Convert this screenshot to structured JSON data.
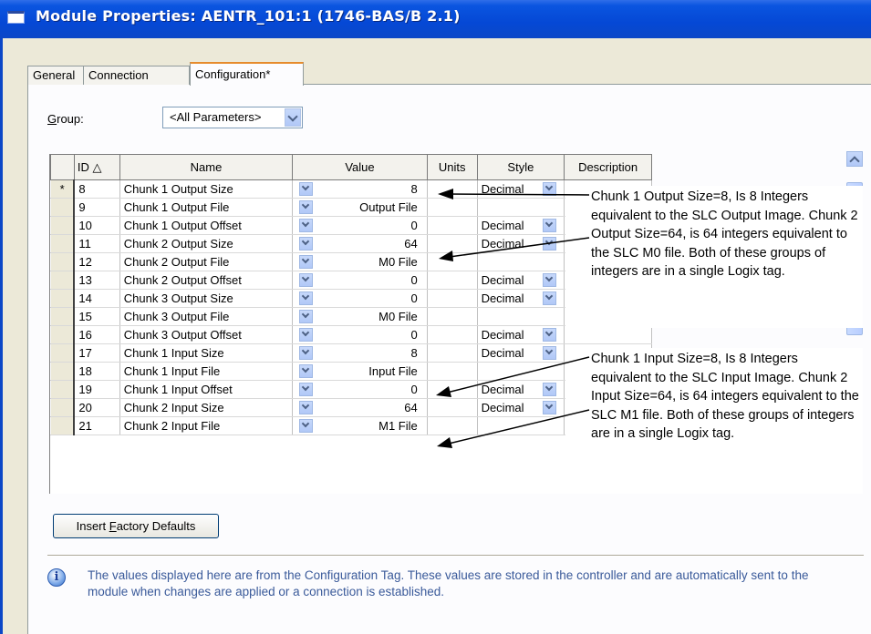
{
  "window": {
    "title": "Module Properties: AENTR_101:1 (1746-BAS/B 2.1)"
  },
  "tabs": [
    {
      "label": "General"
    },
    {
      "label": "Connection"
    },
    {
      "label": "Configuration*"
    }
  ],
  "group": {
    "label_underlined": "G",
    "label_rest": "roup:",
    "value": "<All Parameters>"
  },
  "grid": {
    "headers": {
      "select": "",
      "id": "ID △",
      "name": "Name",
      "value": "Value",
      "units": "Units",
      "style": "Style",
      "description": "Description"
    },
    "current_row_marker": "*",
    "rows": [
      {
        "id": "8",
        "name": "Chunk 1 Output Size",
        "value": "8",
        "style": "Decimal"
      },
      {
        "id": "9",
        "name": "Chunk 1 Output File",
        "value": "Output File",
        "style": ""
      },
      {
        "id": "10",
        "name": "Chunk 1 Output Offset",
        "value": "0",
        "style": "Decimal"
      },
      {
        "id": "11",
        "name": "Chunk 2 Output Size",
        "value": "64",
        "style": "Decimal"
      },
      {
        "id": "12",
        "name": "Chunk 2 Output File",
        "value": "M0 File",
        "style": ""
      },
      {
        "id": "13",
        "name": "Chunk 2 Output Offset",
        "value": "0",
        "style": "Decimal"
      },
      {
        "id": "14",
        "name": "Chunk 3 Output Size",
        "value": "0",
        "style": "Decimal"
      },
      {
        "id": "15",
        "name": "Chunk 3 Output File",
        "value": "M0 File",
        "style": ""
      },
      {
        "id": "16",
        "name": "Chunk 3 Output Offset",
        "value": "0",
        "style": "Decimal"
      },
      {
        "id": "17",
        "name": "Chunk 1 Input Size",
        "value": "8",
        "style": "Decimal"
      },
      {
        "id": "18",
        "name": "Chunk 1 Input File",
        "value": "Input File",
        "style": ""
      },
      {
        "id": "19",
        "name": "Chunk 1 Input Offset",
        "value": "0",
        "style": "Decimal"
      },
      {
        "id": "20",
        "name": "Chunk 2 Input Size",
        "value": "64",
        "style": "Decimal"
      },
      {
        "id": "21",
        "name": "Chunk 2 Input File",
        "value": "M1 File",
        "style": ""
      }
    ]
  },
  "callouts": {
    "output": "Chunk 1 Output Size=8, Is 8 Integers equivalent to the SLC Output Image. Chunk 2 Output Size=64, is 64 integers equivalent to the SLC M0 file. Both of these groups of integers are in a single Logix tag.",
    "input": "Chunk 1 Input Size=8, Is 8 Integers equivalent to the SLC Input Image. Chunk 2 Input Size=64, is 64 integers equivalent to the SLC M1 file. Both of these groups of integers are in a single Logix tag."
  },
  "buttons": {
    "defaults_pre": "Insert ",
    "defaults_u": "F",
    "defaults_post": "actory Defaults"
  },
  "info": {
    "icon": "info-icon",
    "text": "The values displayed here are from the Configuration Tag. These values are stored in the controller and are automatically sent to the module when changes are applied or a connection is established."
  },
  "colors": {
    "titlebar": "#0548d5",
    "info_text": "#3a5a9a",
    "active_tab_accent": "#e68b2c"
  }
}
